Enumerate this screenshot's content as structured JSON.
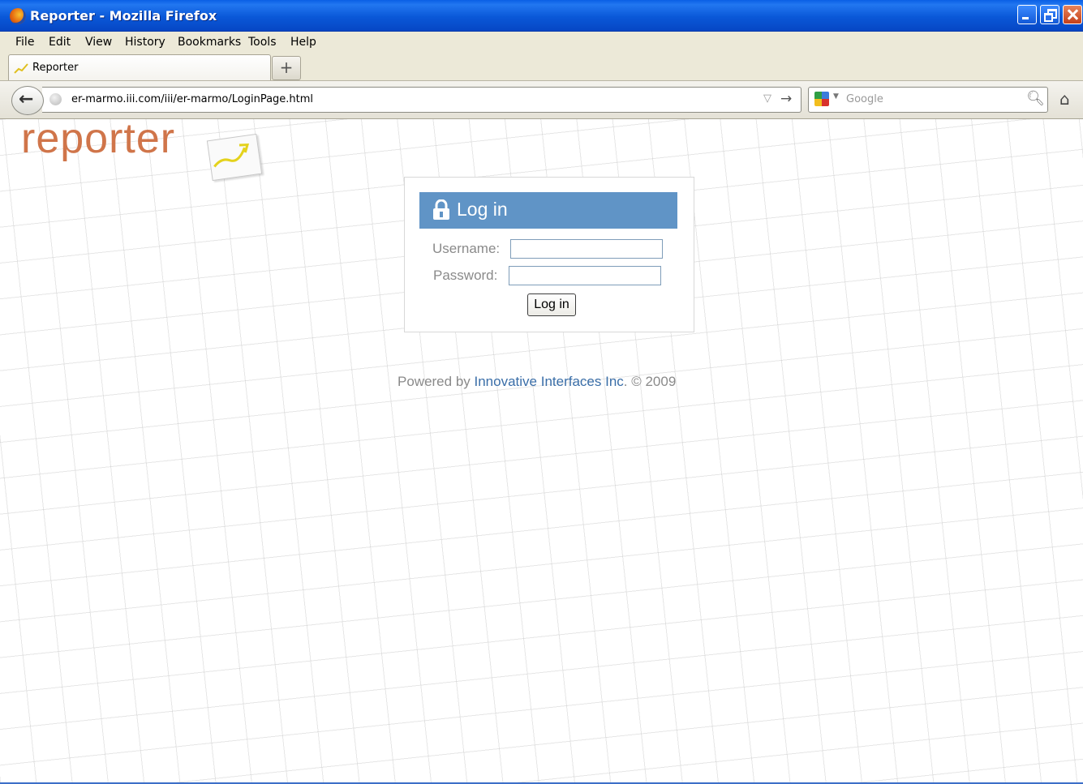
{
  "window": {
    "title": "Reporter - Mozilla Firefox",
    "icon": "firefox-icon"
  },
  "menu": {
    "file": "File",
    "edit": "Edit",
    "view": "View",
    "history": "History",
    "bookmarks": "Bookmarks",
    "tools": "Tools",
    "help": "Help"
  },
  "tabs": [
    {
      "label": "Reporter",
      "icon": "reporter-favicon"
    }
  ],
  "new_tab_label": "+",
  "navigation": {
    "url": "er-marmo.iii.com/iii/er-marmo/LoginPage.html",
    "search_placeholder": "Google",
    "search_engine_icon": "google-icon"
  },
  "page": {
    "logo_text": "reporter",
    "login": {
      "title": "Log in",
      "username_label": "Username:",
      "password_label": "Password:",
      "username_value": "",
      "password_value": "",
      "button_label": "Log in"
    },
    "footer": {
      "prefix": "Powered by ",
      "link": "Innovative Interfaces Inc",
      "suffix": ". © 2009"
    }
  },
  "colors": {
    "titlebar": "#0a5fe5",
    "login_header": "#6094c6",
    "logo": "#d0754a",
    "link": "#3a6ea8"
  }
}
